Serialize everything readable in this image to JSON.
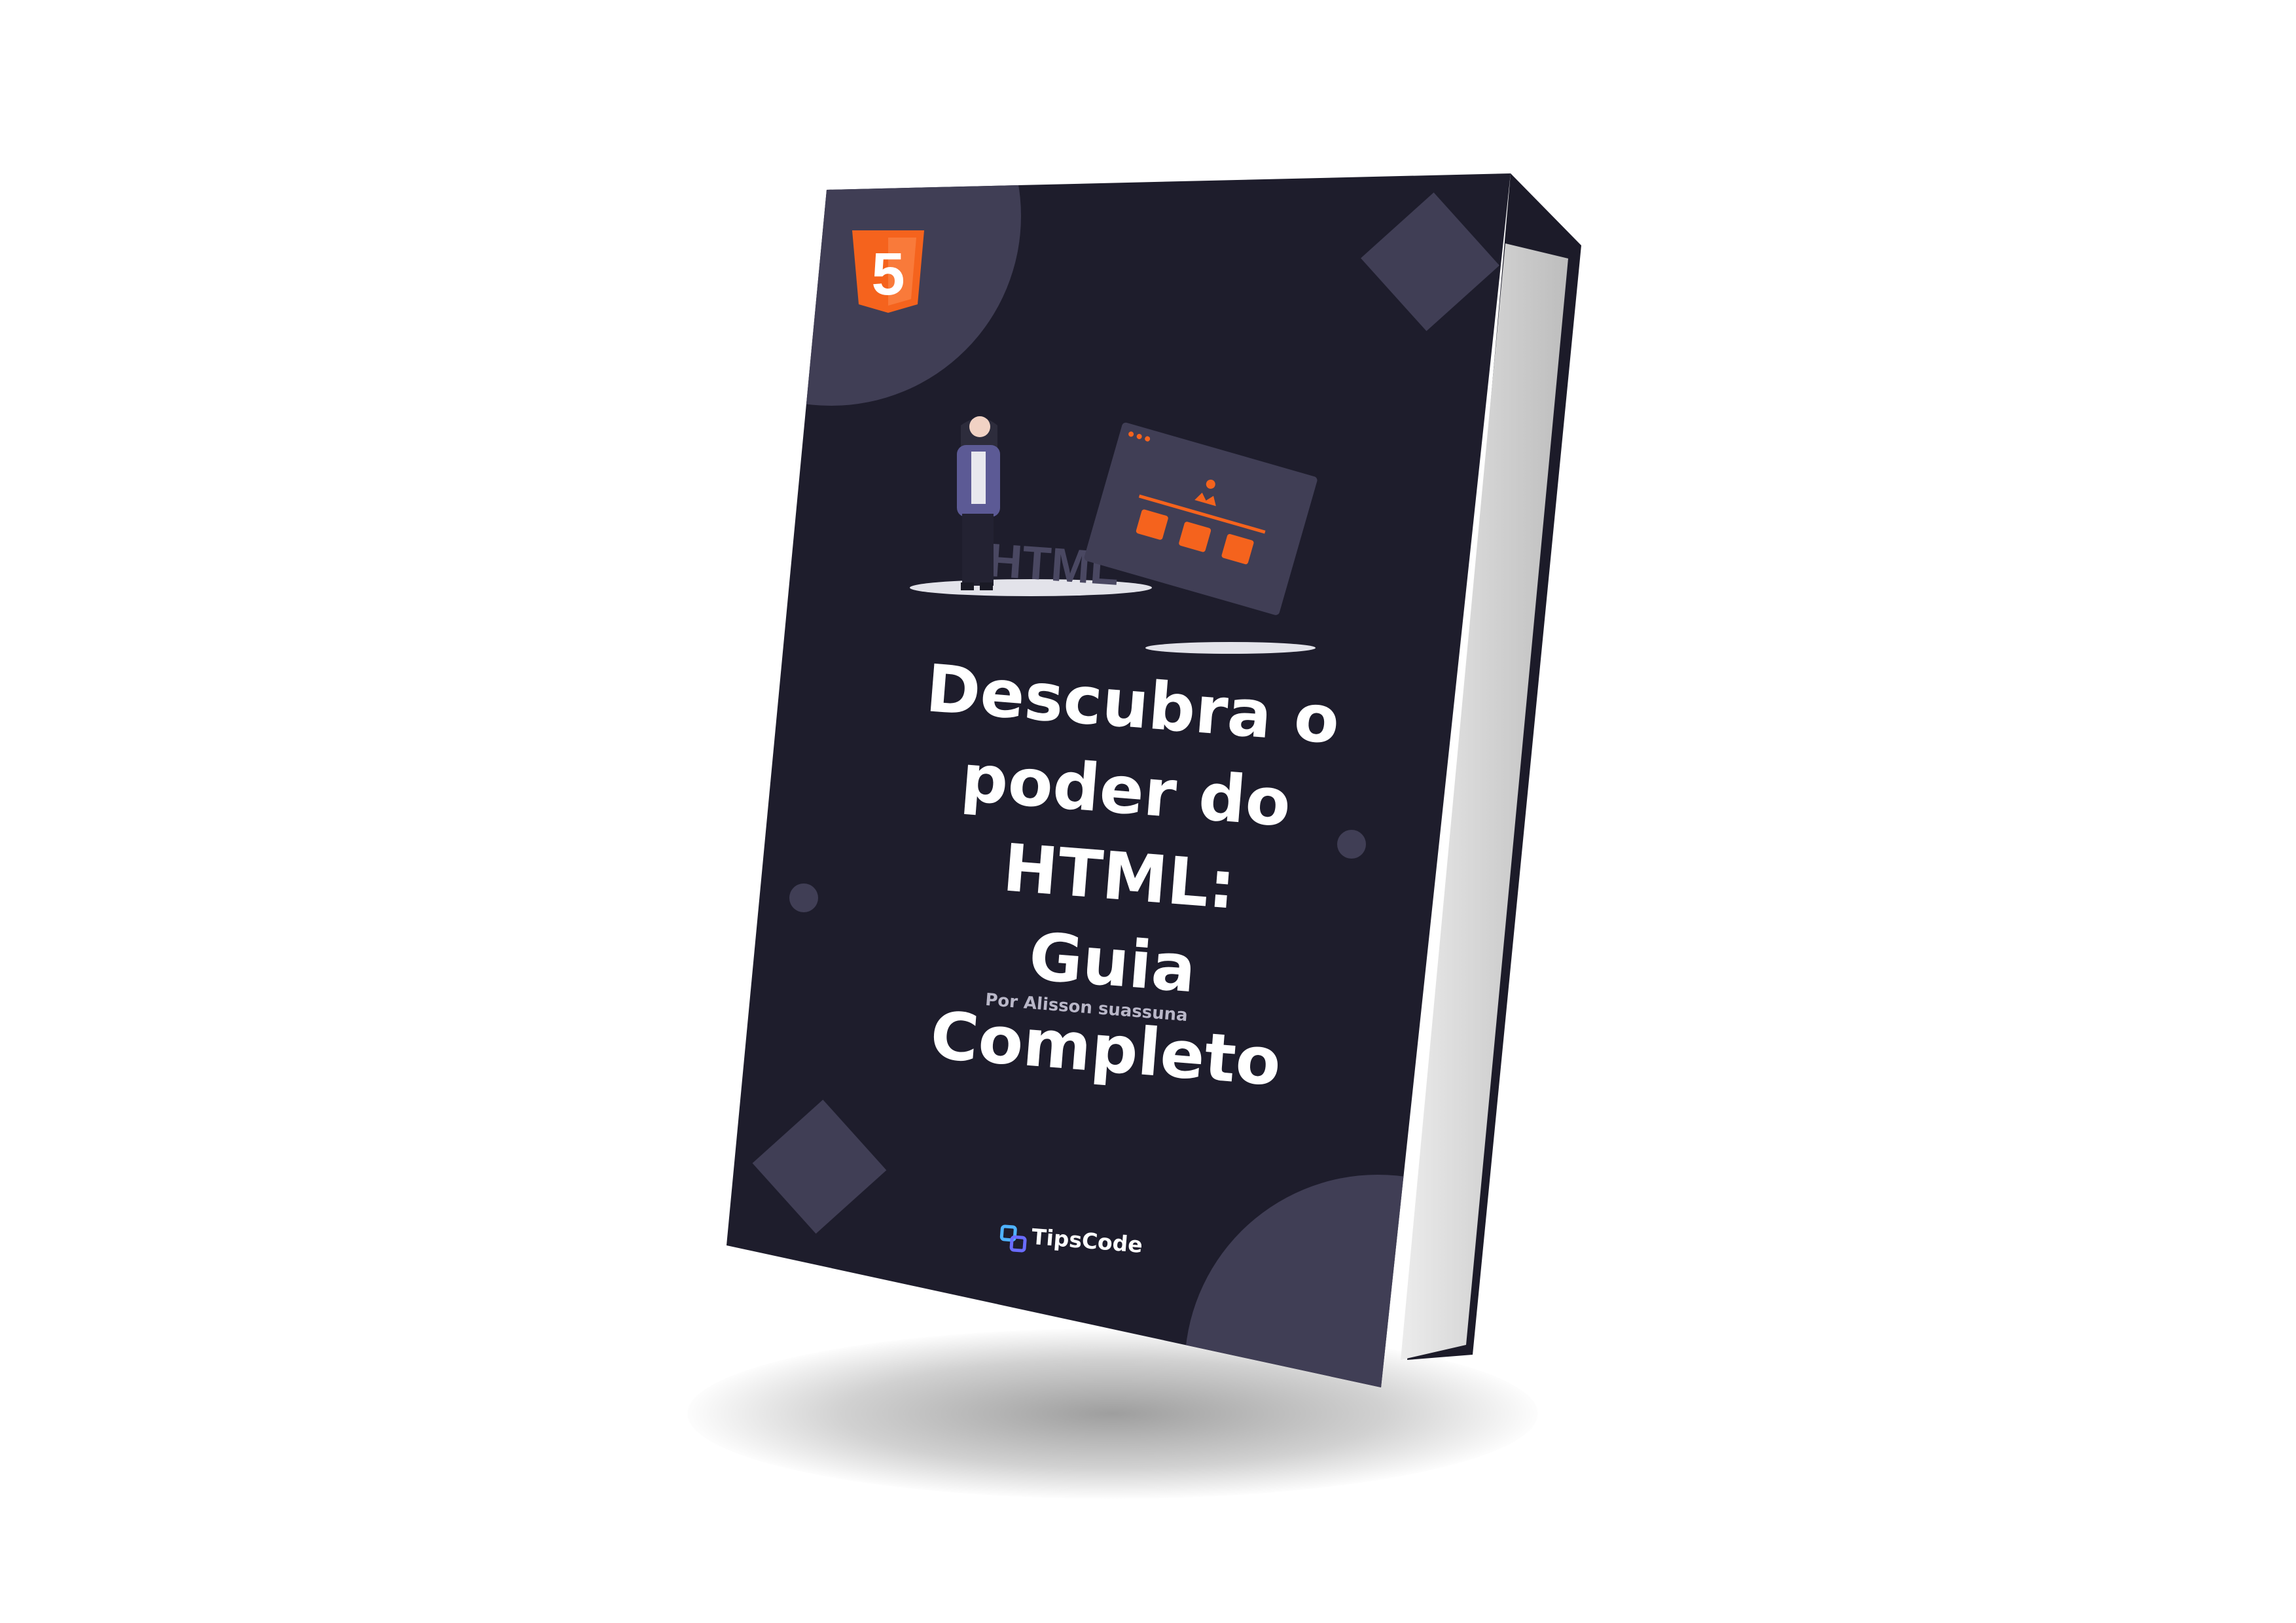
{
  "book": {
    "title_lines": [
      "Descubra o",
      "poder do HTML:",
      "Guia Completo"
    ],
    "author": "Por Alisson suassuna",
    "brand": "TipsCode",
    "illustration_word": "HTML",
    "badge_number": "5"
  },
  "colors": {
    "cover": "#1e1d2c",
    "decor": "#403e55",
    "accent": "#f5631d",
    "pages": "#d9d9d9"
  },
  "icons": [
    "html5-shield-icon",
    "tipscode-logo-icon"
  ]
}
